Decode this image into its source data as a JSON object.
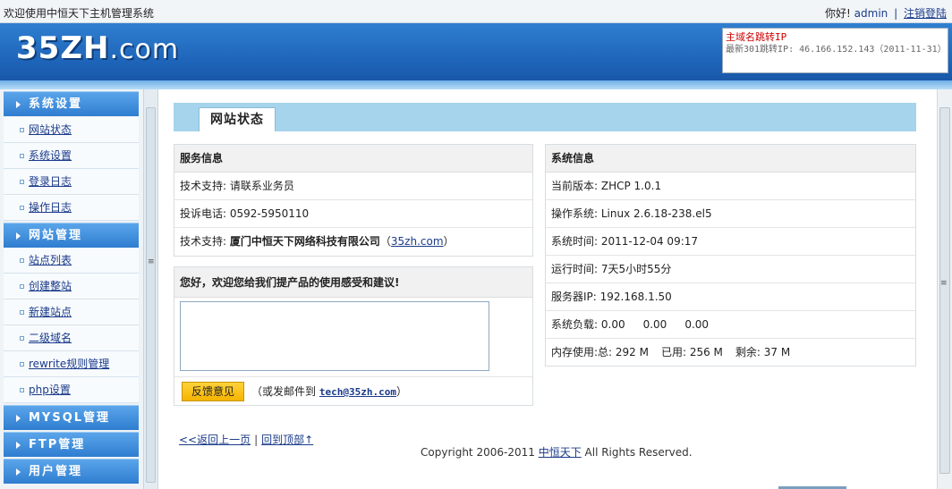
{
  "topbar": {
    "welcome": "欢迎使用中恒天下主机管理系统",
    "greeting": "你好!",
    "username": "admin",
    "separator": "|",
    "logout": "注销登陆"
  },
  "header": {
    "logo_main": "35ZH",
    "logo_domain": ".com",
    "notice_title": "主域名跳转IP",
    "notice_text": "最新301跳转IP: 46.166.152.143（2011-11-31）"
  },
  "sidebar": {
    "sections": [
      {
        "title": "系统设置",
        "items": [
          "网站状态",
          "系统设置",
          "登录日志",
          "操作日志"
        ]
      },
      {
        "title": "网站管理",
        "items": [
          "站点列表",
          "创建整站",
          "新建站点",
          "二级域名",
          "rewrite规则管理",
          "php设置"
        ]
      },
      {
        "title": "MYSQL管理",
        "items": []
      },
      {
        "title": "FTP管理",
        "items": []
      },
      {
        "title": "用户管理",
        "items": []
      }
    ]
  },
  "main": {
    "tab": "网站状态",
    "service": {
      "title": "服务信息",
      "rows": [
        {
          "label": "技术支持:",
          "value": "请联系业务员"
        },
        {
          "label": "投诉电话:",
          "value": "0592-5950110"
        },
        {
          "label": "技术支持:",
          "value": "厦门中恒天下网络科技有限公司",
          "link": "35zh.com"
        }
      ]
    },
    "system": {
      "title": "系统信息",
      "rows": [
        {
          "label": "当前版本:",
          "value": "ZHCP 1.0.1"
        },
        {
          "label": "操作系统:",
          "value": "Linux 2.6.18-238.el5"
        },
        {
          "label": "系统时间:",
          "value": "2011-12-04 09:17"
        },
        {
          "label": "运行时间:",
          "value": "7天5小时55分"
        },
        {
          "label": "服务器IP:",
          "value": "192.168.1.50"
        }
      ],
      "load_label": "系统负载:",
      "load": [
        "0.00",
        "0.00",
        "0.00"
      ],
      "mem_label": "内存使用:",
      "mem_total": "总: 292 M",
      "mem_used": "已用: 256 M",
      "mem_free": "剩余: 37 M"
    },
    "feedback": {
      "title": "您好，欢迎您给我们提产品的使用感受和建议!",
      "textarea_value": "",
      "button": "反馈意见",
      "mail_prefix": "（或发邮件到",
      "mail": "tech@35zh.com",
      "mail_suffix": "）"
    },
    "footer": {
      "back": "<<返回上一页",
      "sep": "|",
      "top": "回到顶部↑",
      "copyright_prefix": "Copyright 2006-2011",
      "company": "中恒天下",
      "copyright_suffix": "All Rights Reserved."
    }
  }
}
